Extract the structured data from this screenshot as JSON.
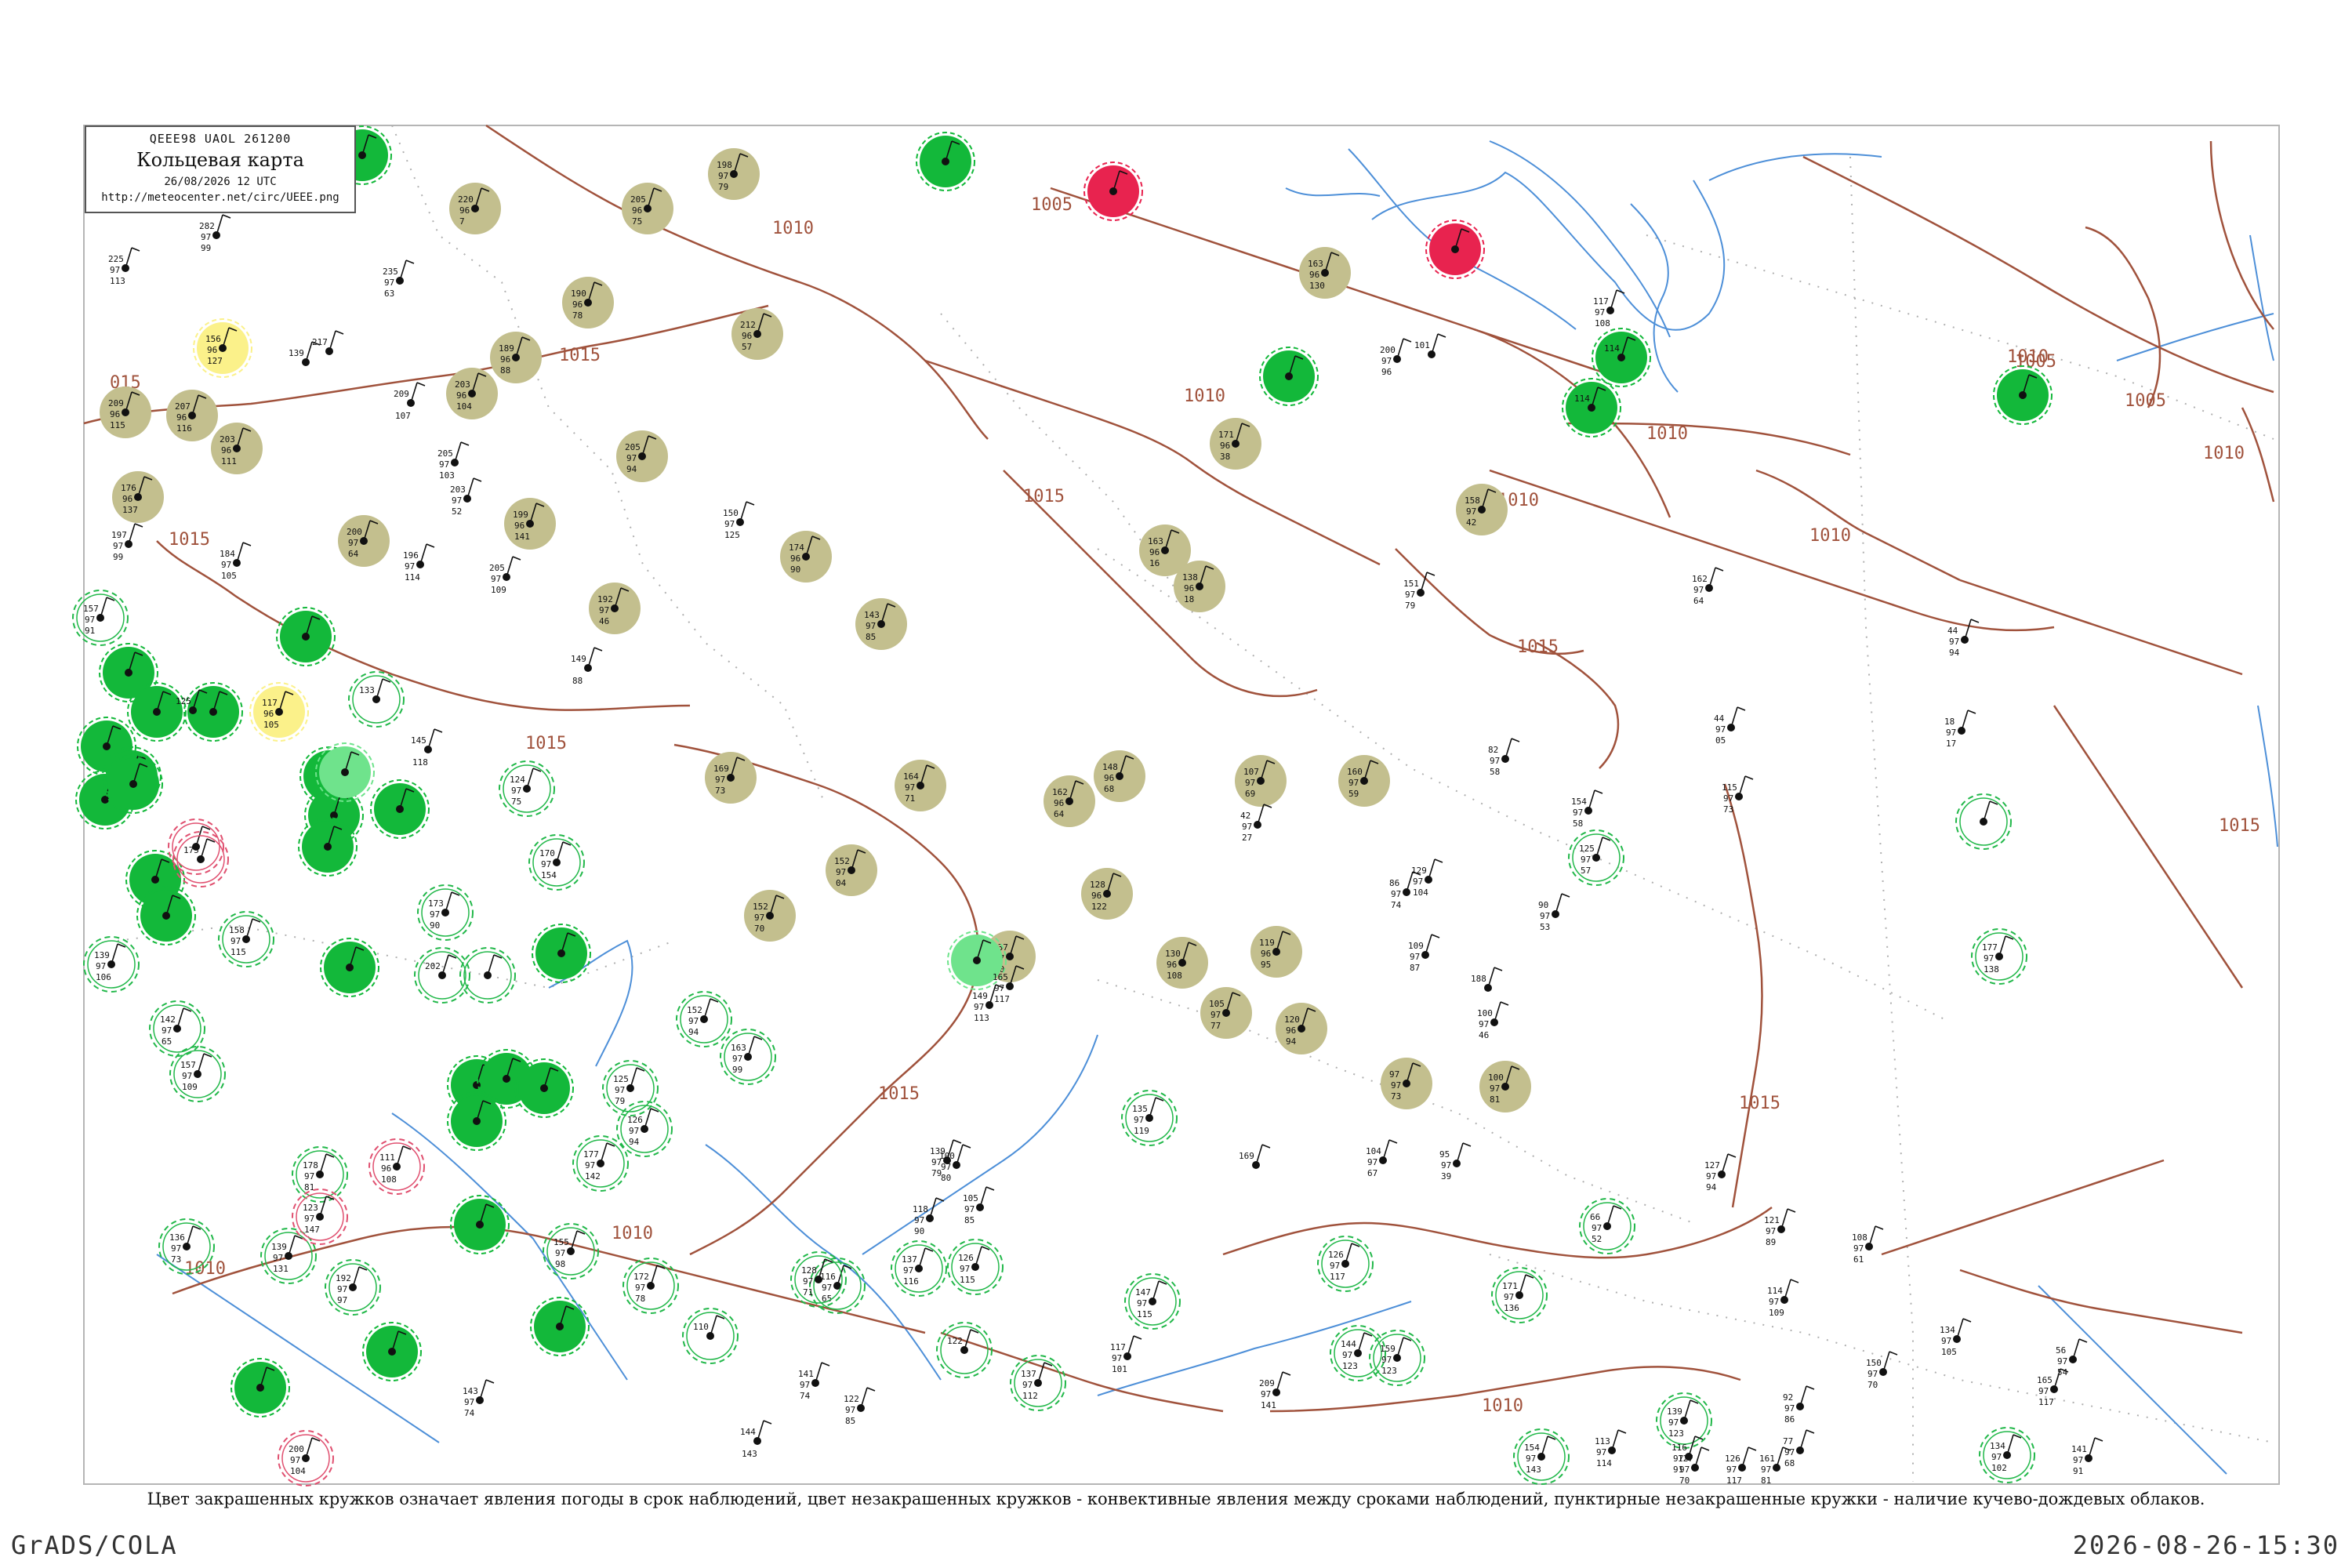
{
  "header": {
    "code": "QEEE98  UAOL  261200",
    "title": "Кольцевая карта",
    "datetime": "26/08/2026 12 UTC",
    "url": "http://meteocenter.net/circ/UEEE.png"
  },
  "isobar_labels": [
    "1005",
    "1010",
    "1015",
    "015",
    "1010",
    "1010",
    "1015",
    "1010",
    "1005",
    "1005",
    "1010",
    "1010",
    "1015",
    "1015",
    "1015",
    "1015",
    "1010",
    "1015",
    "1010",
    "1010",
    "1010",
    "1015"
  ],
  "caption": "Цвет закрашенных кружков означает явления погоды в срок наблюдений, цвет незакрашенных кружков - конвективные явления между сроками наблюдений, пунктирные незакрашенные кружки - наличие кучево-дождевых облаков.",
  "footer": {
    "left": "GrADS/COLA",
    "right": "2026-08-26-15:30"
  },
  "colors": {
    "isobar": "#a0523c",
    "river": "#4d8fd8",
    "border": "#b5b5b5",
    "fill_olive": "#c3bf8e",
    "fill_green": "#13b83a",
    "fill_lightgreen": "#6fe38c",
    "fill_yellow": "#fbf18a",
    "fill_red": "#e8234f",
    "ring_green": "#22b84a",
    "ring_red": "#e05070"
  },
  "stations": [
    {
      "t": "olive",
      "a": "198",
      "b": "97",
      "c": "79"
    },
    {
      "t": "olive",
      "a": "220",
      "b": "96",
      "c": "7"
    },
    {
      "t": "olive",
      "a": "205",
      "b": "96",
      "c": "75"
    },
    {
      "t": "olive",
      "a": "190",
      "b": "96",
      "c": "78"
    },
    {
      "t": "olive",
      "a": "212",
      "b": "96",
      "c": "57"
    },
    {
      "t": "olive",
      "a": "189",
      "b": "96",
      "c": "88"
    },
    {
      "t": "olive",
      "a": "203",
      "b": "96",
      "c": "104"
    },
    {
      "t": "olive",
      "a": "209",
      "b": "96",
      "c": "115"
    },
    {
      "t": "olive",
      "a": "207",
      "b": "96",
      "c": "116"
    },
    {
      "t": "olive",
      "a": "203",
      "b": "96",
      "c": "111"
    },
    {
      "t": "olive",
      "a": "205",
      "b": "97",
      "c": "94"
    },
    {
      "t": "olive",
      "a": "176",
      "b": "96",
      "c": "137"
    },
    {
      "t": "olive",
      "a": "200",
      "b": "97",
      "c": "64"
    },
    {
      "t": "olive",
      "a": "199",
      "b": "96",
      "c": "141"
    },
    {
      "t": "olive",
      "a": "192",
      "b": "97",
      "c": "46"
    },
    {
      "t": "olive",
      "a": "174",
      "b": "96",
      "c": "90"
    },
    {
      "t": "olive",
      "a": "143",
      "b": "97",
      "c": "85"
    },
    {
      "t": "olive",
      "a": "163",
      "b": "96",
      "c": "130"
    },
    {
      "t": "olive",
      "a": "171",
      "b": "96",
      "c": "38"
    },
    {
      "t": "olive",
      "a": "163",
      "b": "96",
      "c": "16"
    },
    {
      "t": "olive",
      "a": "138",
      "b": "96",
      "c": "18"
    },
    {
      "t": "olive",
      "a": "158",
      "b": "97",
      "c": "42"
    },
    {
      "t": "olive",
      "a": "169",
      "b": "97",
      "c": "73"
    },
    {
      "t": "olive",
      "a": "164",
      "b": "97",
      "c": "71"
    },
    {
      "t": "olive",
      "a": "162",
      "b": "96",
      "c": "64"
    },
    {
      "t": "olive",
      "a": "148",
      "b": "96",
      "c": "68"
    },
    {
      "t": "olive",
      "a": "107",
      "b": "97",
      "c": "69"
    },
    {
      "t": "olive",
      "a": "160",
      "b": "97",
      "c": "59"
    },
    {
      "t": "olive",
      "a": "152",
      "b": "97",
      "c": "04"
    },
    {
      "t": "olive",
      "a": "128",
      "b": "96",
      "c": "122"
    },
    {
      "t": "olive",
      "a": "152",
      "b": "97",
      "c": "70"
    },
    {
      "t": "olive",
      "a": "137",
      "b": "97",
      "c": "90"
    },
    {
      "t": "olive",
      "a": "130",
      "b": "96",
      "c": "108"
    },
    {
      "t": "olive",
      "a": "119",
      "b": "96",
      "c": "95"
    },
    {
      "t": "olive",
      "a": "105",
      "b": "97",
      "c": "77"
    },
    {
      "t": "olive",
      "a": "120",
      "b": "96",
      "c": "94"
    },
    {
      "t": "olive",
      "a": "97",
      "b": "97",
      "c": "73"
    },
    {
      "t": "olive",
      "a": "100",
      "b": "97",
      "c": "81"
    },
    {
      "t": "green",
      "a": "",
      "b": "",
      "c": ""
    },
    {
      "t": "green",
      "a": "",
      "b": "",
      "c": ""
    },
    {
      "t": "green",
      "a": "",
      "b": "",
      "c": ""
    },
    {
      "t": "green",
      "a": "114",
      "b": "",
      "c": ""
    },
    {
      "t": "green",
      "a": "114",
      "b": "",
      "c": ""
    },
    {
      "t": "green",
      "a": "",
      "b": "",
      "c": ""
    },
    {
      "t": "green",
      "a": "",
      "b": "",
      "c": ""
    },
    {
      "t": "green",
      "a": "",
      "b": "",
      "c": ""
    },
    {
      "t": "green",
      "a": "",
      "b": "",
      "c": ""
    },
    {
      "t": "green",
      "a": "",
      "b": "",
      "c": ""
    },
    {
      "t": "green",
      "a": "",
      "b": "",
      "c": ""
    },
    {
      "t": "green",
      "a": "",
      "b": "",
      "c": ""
    },
    {
      "t": "green",
      "a": "",
      "b": "",
      "c": ""
    },
    {
      "t": "green",
      "a": "",
      "b": "",
      "c": ""
    },
    {
      "t": "green",
      "a": "",
      "b": "",
      "c": ""
    },
    {
      "t": "green",
      "a": "",
      "b": "",
      "c": ""
    },
    {
      "t": "green",
      "a": "",
      "b": "",
      "c": ""
    },
    {
      "t": "green",
      "a": "",
      "b": "",
      "c": ""
    },
    {
      "t": "green",
      "a": "",
      "b": "",
      "c": ""
    },
    {
      "t": "green",
      "a": "",
      "b": "",
      "c": ""
    },
    {
      "t": "green",
      "a": "",
      "b": "",
      "c": ""
    },
    {
      "t": "green",
      "a": "",
      "b": "",
      "c": ""
    },
    {
      "t": "green",
      "a": "",
      "b": "",
      "c": ""
    },
    {
      "t": "green",
      "a": "",
      "b": "",
      "c": ""
    },
    {
      "t": "green",
      "a": "",
      "b": "",
      "c": ""
    },
    {
      "t": "green",
      "a": "",
      "b": "",
      "c": ""
    },
    {
      "t": "green",
      "a": "",
      "b": "",
      "c": ""
    },
    {
      "t": "green",
      "a": "",
      "b": "",
      "c": ""
    },
    {
      "t": "green",
      "a": "",
      "b": "",
      "c": ""
    },
    {
      "t": "green",
      "a": "",
      "b": "",
      "c": ""
    },
    {
      "t": "lightgreen",
      "a": "",
      "b": "",
      "c": ""
    },
    {
      "t": "lightgreen",
      "a": "",
      "b": "",
      "c": ""
    },
    {
      "t": "yellow",
      "a": "156",
      "b": "96",
      "c": "127"
    },
    {
      "t": "yellow",
      "a": "117",
      "b": "96",
      "c": "105"
    },
    {
      "t": "red",
      "a": "",
      "b": "",
      "c": ""
    },
    {
      "t": "red",
      "a": "",
      "b": "",
      "c": ""
    },
    {
      "t": "ring",
      "a": "177",
      "b": "97",
      "c": "138"
    },
    {
      "t": "ring",
      "a": "139",
      "b": "97",
      "c": "131"
    },
    {
      "t": "ring",
      "a": "157",
      "b": "97",
      "c": "91"
    },
    {
      "t": "ring",
      "a": "133",
      "b": "",
      "c": ""
    },
    {
      "t": "ring",
      "a": "124",
      "b": "97",
      "c": "75"
    },
    {
      "t": "ring",
      "a": "170",
      "b": "97",
      "c": "154"
    },
    {
      "t": "ring",
      "a": "173",
      "b": "97",
      "c": "90"
    },
    {
      "t": "ring",
      "a": "158",
      "b": "97",
      "c": "115"
    },
    {
      "t": "ring",
      "a": "139",
      "b": "97",
      "c": "106"
    },
    {
      "t": "ring",
      "a": "202",
      "b": "",
      "c": ""
    },
    {
      "t": "ring",
      "a": "",
      "b": "",
      "c": ""
    },
    {
      "t": "ring",
      "a": "142",
      "b": "97",
      "c": "65"
    },
    {
      "t": "ring",
      "a": "157",
      "b": "97",
      "c": "109"
    },
    {
      "t": "ring",
      "a": "152",
      "b": "97",
      "c": "94"
    },
    {
      "t": "ring",
      "a": "125",
      "b": "97",
      "c": "79"
    },
    {
      "t": "ring",
      "a": "126",
      "b": "97",
      "c": "94"
    },
    {
      "t": "ring",
      "a": "163",
      "b": "97",
      "c": "99"
    },
    {
      "t": "ring",
      "a": "177",
      "b": "97",
      "c": "142"
    },
    {
      "t": "ring",
      "a": "178",
      "b": "97",
      "c": "81"
    },
    {
      "t": "ring",
      "a": "136",
      "b": "97",
      "c": "73"
    },
    {
      "t": "ring",
      "a": "192",
      "b": "97",
      "c": "97"
    },
    {
      "t": "ring",
      "a": "155",
      "b": "97",
      "c": "98"
    },
    {
      "t": "ring",
      "a": "172",
      "b": "97",
      "c": "78"
    },
    {
      "t": "ring",
      "a": "110",
      "b": "",
      "c": ""
    },
    {
      "t": "ring",
      "a": "116",
      "b": "97",
      "c": "65"
    },
    {
      "t": "ring",
      "a": "128",
      "b": "97",
      "c": "71"
    },
    {
      "t": "ring",
      "a": "137",
      "b": "97",
      "c": "116"
    },
    {
      "t": "ring",
      "a": "126",
      "b": "97",
      "c": "115"
    },
    {
      "t": "ring",
      "a": "122",
      "b": "",
      "c": ""
    },
    {
      "t": "ring",
      "a": "137",
      "b": "97",
      "c": "112"
    },
    {
      "t": "ring",
      "a": "147",
      "b": "97",
      "c": "115"
    },
    {
      "t": "ring",
      "a": "135",
      "b": "97",
      "c": "119"
    },
    {
      "t": "ring",
      "a": "126",
      "b": "97",
      "c": "117"
    },
    {
      "t": "ring",
      "a": "144",
      "b": "97",
      "c": "123"
    },
    {
      "t": "ring",
      "a": "159",
      "b": "97",
      "c": "123"
    },
    {
      "t": "ring",
      "a": "171",
      "b": "97",
      "c": "136"
    },
    {
      "t": "ring",
      "a": "66",
      "b": "97",
      "c": "52"
    },
    {
      "t": "ring",
      "a": "139",
      "b": "97",
      "c": "123"
    },
    {
      "t": "ring",
      "a": "154",
      "b": "97",
      "c": "143"
    },
    {
      "t": "ring",
      "a": "125",
      "b": "97",
      "c": "57"
    },
    {
      "t": "ring",
      "a": "",
      "b": "",
      "c": ""
    },
    {
      "t": "ring",
      "a": "134",
      "b": "97",
      "c": "102"
    },
    {
      "t": "ringred",
      "a": "",
      "b": "",
      "c": ""
    },
    {
      "t": "ringred",
      "a": "111",
      "b": "96",
      "c": "108"
    },
    {
      "t": "ringred",
      "a": "123",
      "b": "97",
      "c": "147"
    },
    {
      "t": "ringred",
      "a": "200",
      "b": "97",
      "c": "104"
    },
    {
      "t": "ringred",
      "a": "175",
      "b": "",
      "c": ""
    },
    {
      "t": "small",
      "a": "225",
      "b": "97",
      "c": "113"
    },
    {
      "t": "small",
      "a": "282",
      "b": "97",
      "c": "99"
    },
    {
      "t": "small",
      "a": "235",
      "b": "97",
      "c": "63"
    },
    {
      "t": "small",
      "a": "217",
      "b": "",
      "c": ""
    },
    {
      "t": "small",
      "a": "139",
      "b": "",
      "c": ""
    },
    {
      "t": "small",
      "a": "209",
      "b": "",
      "c": "107"
    },
    {
      "t": "small",
      "a": "205",
      "b": "97",
      "c": "103"
    },
    {
      "t": "small",
      "a": "203",
      "b": "97",
      "c": "52"
    },
    {
      "t": "small",
      "a": "197",
      "b": "97",
      "c": "99"
    },
    {
      "t": "small",
      "a": "184",
      "b": "97",
      "c": "105"
    },
    {
      "t": "small",
      "a": "196",
      "b": "97",
      "c": "114"
    },
    {
      "t": "small",
      "a": "205",
      "b": "97",
      "c": "109"
    },
    {
      "t": "small",
      "a": "150",
      "b": "97",
      "c": "125"
    },
    {
      "t": "small",
      "a": "149",
      "b": "",
      "c": "88"
    },
    {
      "t": "small",
      "a": "125",
      "b": "",
      "c": ""
    },
    {
      "t": "small",
      "a": "145",
      "b": "",
      "c": "118"
    },
    {
      "t": "small",
      "a": "200",
      "b": "97",
      "c": "96"
    },
    {
      "t": "small",
      "a": "101",
      "b": "",
      "c": ""
    },
    {
      "t": "small",
      "a": "117",
      "b": "97",
      "c": "108"
    },
    {
      "t": "small",
      "a": "151",
      "b": "97",
      "c": "79"
    },
    {
      "t": "small",
      "a": "162",
      "b": "97",
      "c": "64"
    },
    {
      "t": "small",
      "a": "44",
      "b": "97",
      "c": "94"
    },
    {
      "t": "small",
      "a": "44",
      "b": "97",
      "c": "05"
    },
    {
      "t": "small",
      "a": "18",
      "b": "97",
      "c": "17"
    },
    {
      "t": "small",
      "a": "82",
      "b": "97",
      "c": "58"
    },
    {
      "t": "small",
      "a": "154",
      "b": "97",
      "c": "58"
    },
    {
      "t": "small",
      "a": "115",
      "b": "97",
      "c": "73"
    },
    {
      "t": "small",
      "a": "42",
      "b": "97",
      "c": "27"
    },
    {
      "t": "small",
      "a": "129",
      "b": "97",
      "c": "104"
    },
    {
      "t": "small",
      "a": "109",
      "b": "97",
      "c": "87"
    },
    {
      "t": "small",
      "a": "100",
      "b": "97",
      "c": "46"
    },
    {
      "t": "small",
      "a": "86",
      "b": "97",
      "c": "74"
    },
    {
      "t": "small",
      "a": "90",
      "b": "97",
      "c": "53"
    },
    {
      "t": "small",
      "a": "188",
      "b": "",
      "c": ""
    },
    {
      "t": "small",
      "a": "165",
      "b": "97",
      "c": "117"
    },
    {
      "t": "small",
      "a": "149",
      "b": "97",
      "c": "113"
    },
    {
      "t": "small",
      "a": "169",
      "b": "",
      "c": ""
    },
    {
      "t": "small",
      "a": "104",
      "b": "97",
      "c": "67"
    },
    {
      "t": "small",
      "a": "95",
      "b": "97",
      "c": "39"
    },
    {
      "t": "small",
      "a": "127",
      "b": "97",
      "c": "94"
    },
    {
      "t": "small",
      "a": "121",
      "b": "97",
      "c": "89"
    },
    {
      "t": "small",
      "a": "108",
      "b": "97",
      "c": "61"
    },
    {
      "t": "small",
      "a": "150",
      "b": "97",
      "c": "70"
    },
    {
      "t": "small",
      "a": "134",
      "b": "97",
      "c": "105"
    },
    {
      "t": "small",
      "a": "56",
      "b": "97",
      "c": "54"
    },
    {
      "t": "small",
      "a": "114",
      "b": "97",
      "c": "109"
    },
    {
      "t": "small",
      "a": "92",
      "b": "97",
      "c": "86"
    },
    {
      "t": "small",
      "a": "77",
      "b": "97",
      "c": "68"
    },
    {
      "t": "small",
      "a": "113",
      "b": "97",
      "c": "114"
    },
    {
      "t": "small",
      "a": "116",
      "b": "97",
      "c": "91"
    },
    {
      "t": "small",
      "a": "143",
      "b": "97",
      "c": "74"
    },
    {
      "t": "small",
      "a": "209",
      "b": "97",
      "c": "141"
    },
    {
      "t": "small",
      "a": "141",
      "b": "97",
      "c": "74"
    },
    {
      "t": "small",
      "a": "122",
      "b": "97",
      "c": "85"
    },
    {
      "t": "small",
      "a": "117",
      "b": "97",
      "c": "101"
    },
    {
      "t": "small",
      "a": "144",
      "b": "",
      "c": "143"
    },
    {
      "t": "small",
      "a": "139",
      "b": "97",
      "c": "79"
    },
    {
      "t": "small",
      "a": "105",
      "b": "97",
      "c": "85"
    },
    {
      "t": "small",
      "a": "118",
      "b": "97",
      "c": "90"
    },
    {
      "t": "small",
      "a": "100",
      "b": "97",
      "c": "80"
    },
    {
      "t": "small",
      "a": "127",
      "b": "97",
      "c": "70"
    },
    {
      "t": "small",
      "a": "126",
      "b": "97",
      "c": "117"
    },
    {
      "t": "small",
      "a": "161",
      "b": "97",
      "c": "81"
    },
    {
      "t": "small",
      "a": "165",
      "b": "97",
      "c": "117"
    },
    {
      "t": "small",
      "a": "141",
      "b": "97",
      "c": "91"
    },
    {
      "t": "small",
      "a": "136",
      "b": "97",
      "c": "122"
    },
    {
      "t": "small",
      "a": "102",
      "b": "97",
      "c": "64"
    },
    {
      "t": "small",
      "a": "163",
      "b": "97",
      "c": "100"
    }
  ]
}
